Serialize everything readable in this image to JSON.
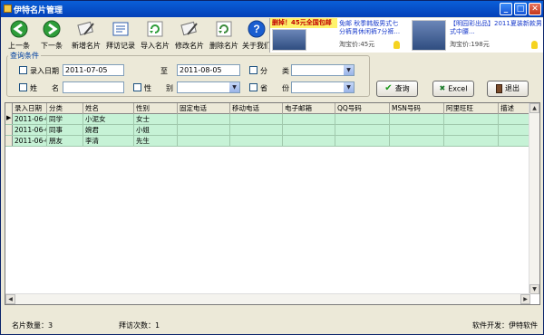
{
  "window": {
    "title": "伊特名片管理",
    "min": "_",
    "max": "□",
    "close": "✕"
  },
  "toolbar": [
    {
      "name": "up-button",
      "label": "上一条",
      "icon": "arrow-left-icon",
      "color": "#2e9d3a"
    },
    {
      "name": "down-button",
      "label": "下一条",
      "icon": "arrow-right-icon",
      "color": "#2e9d3a"
    },
    {
      "name": "add-card-button",
      "label": "新增名片",
      "icon": "card-add-icon",
      "color": "#707070"
    },
    {
      "name": "visit-record-button",
      "label": "拜访记录",
      "icon": "notebook-icon",
      "color": "#3060b0"
    },
    {
      "name": "import-card-button",
      "label": "导入名片",
      "icon": "refresh-icon",
      "color": "#2e9d3a"
    },
    {
      "name": "edit-card-button",
      "label": "修改名片",
      "icon": "card-edit-icon",
      "color": "#707070"
    },
    {
      "name": "delete-card-button",
      "label": "删除名片",
      "icon": "recycle-icon",
      "color": "#3a8a3a"
    },
    {
      "name": "about-button",
      "label": "关于我们",
      "icon": "help-icon",
      "color": "#1a5ed0"
    }
  ],
  "ads": {
    "ad1": {
      "banner": "删掉！45元全国包邮",
      "text": "免邮 秋季韩版男式七分裤男休闲裤7分裤...",
      "price": "淘宝价:45元"
    },
    "ad2": {
      "text": "【明园彩出品】2011夏装新款男式中腰...",
      "price": "淘宝价:198元"
    }
  },
  "query": {
    "legend": "查询条件",
    "date_label": "录入日期",
    "date_from": "2011-07-05",
    "to_label": "至",
    "date_to": "2011-08-05",
    "category_label": "分　　类",
    "name_label": "姓　　名",
    "gender_label": "性　　别",
    "province_label": "省　　份"
  },
  "buttons": {
    "search": "查询",
    "excel": "Excel",
    "exit": "退出"
  },
  "table": {
    "columns": [
      "录入日期",
      "分类",
      "姓名",
      "性别",
      "固定电话",
      "移动电话",
      "电子邮箱",
      "QQ号码",
      "MSN号码",
      "阿里旺旺",
      "描述"
    ],
    "rows": [
      [
        "2011-06-02",
        "同学",
        "小泥女",
        "女士",
        "",
        "",
        "",
        "",
        "",
        "",
        ""
      ],
      [
        "2011-06-02",
        "同事",
        "婉君",
        "小姐",
        "",
        "",
        "",
        "",
        "",
        "",
        ""
      ],
      [
        "2011-06-02",
        "朋友",
        "李清",
        "先生",
        "",
        "",
        "",
        "",
        "",
        "",
        ""
      ]
    ]
  },
  "status": {
    "count": "名片数量：3",
    "visits": "拜访次数：1",
    "developer": "软件开发：伊特软件"
  }
}
